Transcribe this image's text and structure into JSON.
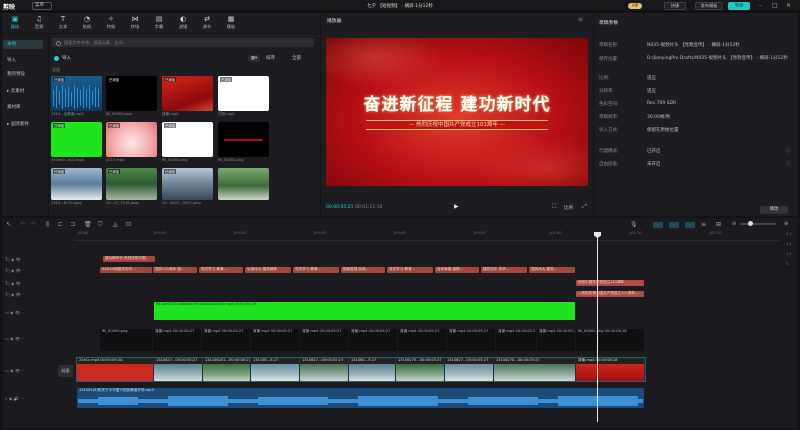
{
  "titlebar": {
    "app_name": "剪映",
    "menu": "菜单",
    "project_title": "七夕 【短视频】 - 横屏-1分12秒",
    "vip": "VIP",
    "btn_shortcut": "快捷",
    "btn_publish": "发布模板",
    "btn_export": "导出"
  },
  "toolbar": {
    "items": [
      {
        "label": "媒体",
        "icon": "media-icon"
      },
      {
        "label": "音频",
        "icon": "audio-icon"
      },
      {
        "label": "文本",
        "icon": "text-icon"
      },
      {
        "label": "贴纸",
        "icon": "sticker-icon"
      },
      {
        "label": "特效",
        "icon": "effect-icon"
      },
      {
        "label": "转场",
        "icon": "transition-icon"
      },
      {
        "label": "字幕",
        "icon": "subtitle-icon"
      },
      {
        "label": "滤镜",
        "icon": "filter-icon"
      },
      {
        "label": "调节",
        "icon": "adjust-icon"
      },
      {
        "label": "模板",
        "icon": "template-icon"
      }
    ]
  },
  "sidenav": {
    "items": [
      "本地",
      "导入",
      "我的预设",
      "▸ 云素材",
      "素材库",
      "▸ 品牌素材"
    ]
  },
  "media": {
    "search_placeholder": "搜索文件名称、画面元素、台词",
    "import": "导入",
    "sort": "排序",
    "all": "全部",
    "section": "全部",
    "items": [
      {
        "name": "1310...品牌曲.mp3",
        "added": "已添加"
      },
      {
        "name": "fill_00000.png",
        "added": "已添加"
      },
      {
        "name": "背景.mp4",
        "added": "已添加"
      },
      {
        "name": "白底.mp4",
        "added": "已添加"
      },
      {
        "name": "941be0...b02.mp4",
        "added": "已添加"
      },
      {
        "name": "0017.mp4",
        "added": "已添加"
      },
      {
        "name": "fill_00000.png",
        "added": "已添加"
      },
      {
        "name": "fill_00000.png",
        "added": ""
      },
      {
        "name": "1310...8170.jpeg",
        "added": "已添加"
      },
      {
        "name": "13...27_7145.jpeg",
        "added": "已添加"
      },
      {
        "name": "13...0627...3297.jpeg",
        "added": "已添加"
      }
    ]
  },
  "player": {
    "title": "播放器",
    "headline": "奋进新征程 建功新时代",
    "subline": "— 热烈庆祝中国共产党成立101周年 —",
    "time_current": "00:00:05:21",
    "time_total": "00:01:11:10",
    "ratio": "比例"
  },
  "props": {
    "title": "草稿参数",
    "rows": [
      {
        "k": "草稿名称:",
        "v": "N035-视频片头 【党政宣传】 - 横屏-1分12秒"
      },
      {
        "k": "保存位置:",
        "v": "D:/JianyingPro Drafts/N035-视频片头 【党政宣传】 - 横屏-1分12秒"
      },
      {
        "k": "比例:",
        "v": "适应"
      },
      {
        "k": "分辨率:",
        "v": "适应"
      },
      {
        "k": "色彩空间:",
        "v": "Rec.709 SDR"
      },
      {
        "k": "草稿帧率:",
        "v": "30.00帧/秒"
      },
      {
        "k": "导入方式:",
        "v": "保留在原始位置"
      },
      {
        "k": "代理模式:",
        "v": "已开启"
      },
      {
        "k": "自由层级:",
        "v": "未开启"
      }
    ],
    "modify": "修改"
  },
  "timeline": {
    "ruler": [
      "00:00",
      "|00:10",
      "|00:20",
      "|00:30",
      "|00:40",
      "|00:50",
      "|01:00",
      "|01:10",
      "|01:20"
    ],
    "text_row1": [
      "建功新时代 热烈庆祝中国..."
    ],
    "text_row2": [
      "XXXXX团委庆祝中...",
      "党的101周年 激...",
      "党史学习 教育...",
      "弘扬伟大 建党精神",
      "党史学习 教育...",
      "国家富强 民族...",
      "党史学习 教育...",
      "百年辉煌 砥砺...",
      "建党百年 风华...",
      "党的伟大 建党...",
      "党的生日 中国...",
      "庆祝建党 百年华...",
      "党建工作 光辉..."
    ],
    "text_row3": [
      "庆祝中国共产党成立101周年"
    ],
    "text_row4": [
      "—热烈庆祝中国共产党成立101周年—"
    ],
    "green_clip": "941be9152340ba2a090d5b1a42cb32.mp4  00:00:55:29",
    "mid_clips": [
      "fill_00000.png",
      "背景.mp4 00:00:05:27",
      "背景.mp4 00:00:05:27",
      "背景.mp4 00:00:05:27",
      "背景.mp4 00:00:05:27",
      "背景.mp4 00:00:05:27",
      "背景.mp4 00:00:05:27",
      "背景.mp4 00:00:05:27",
      "背景.mp4 00:00:05:27",
      "背景.mp4 00:00:05:27",
      "fill_00000.png 00:00:06:18"
    ],
    "main_clips": [
      "22e1c.mp4  00:00:09:24",
      "1310627...00:00:05:27",
      "131106201...00:00:05:27",
      "131108...5:27",
      "1310627...00:00:05:27",
      "131062...5:27",
      "13106270...00:00:05:27",
      "1310627...00:00:05:27",
      "13106270...00:00:05:27",
      "背景.mp4 00:00:08:18"
    ],
    "cover": "封面",
    "audio_clip": "131001(5)的关于中华复兴的品牌曲开场.mp3"
  }
}
